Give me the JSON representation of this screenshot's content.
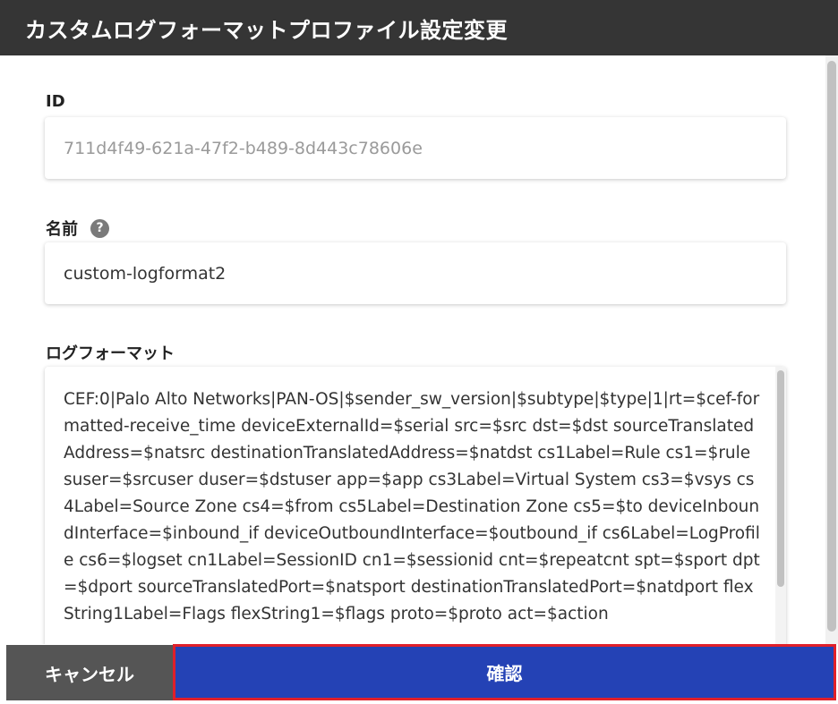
{
  "dialog": {
    "title": "カスタムログフォーマットプロファイル設定変更"
  },
  "fields": {
    "id": {
      "label": "ID",
      "value": "711d4f49-621a-47f2-b489-8d443c78606e"
    },
    "name": {
      "label": "名前",
      "help_icon": "?",
      "value": "custom-logformat2"
    },
    "log_format": {
      "label": "ログフォーマット",
      "value": "CEF:0|Palo Alto Networks|PAN-OS|$sender_sw_version|$subtype|$type|1|rt=$cef-formatted-receive_time deviceExternalId=$serial src=$src dst=$dst sourceTranslatedAddress=$natsrc destinationTranslatedAddress=$natdst cs1Label=Rule cs1=$rule suser=$srcuser duser=$dstuser app=$app cs3Label=Virtual System cs3=$vsys cs4Label=Source Zone cs4=$from cs5Label=Destination Zone cs5=$to deviceInboundInterface=$inbound_if deviceOutboundInterface=$outbound_if cs6Label=LogProfile cs6=$logset cn1Label=SessionID cn1=$sessionid cnt=$repeatcnt spt=$sport dpt=$dport sourceTranslatedPort=$natsport destinationTranslatedPort=$natdport flexString1Label=Flags flexString1=$flags proto=$proto act=$action"
    }
  },
  "footer": {
    "cancel_label": "キャンセル",
    "confirm_label": "確認"
  },
  "colors": {
    "header_bg": "#353535",
    "cancel_bg": "#555555",
    "confirm_bg": "#2442b5",
    "highlight_border": "#e0202a"
  },
  "icons": {
    "help": "help-circle-icon"
  }
}
